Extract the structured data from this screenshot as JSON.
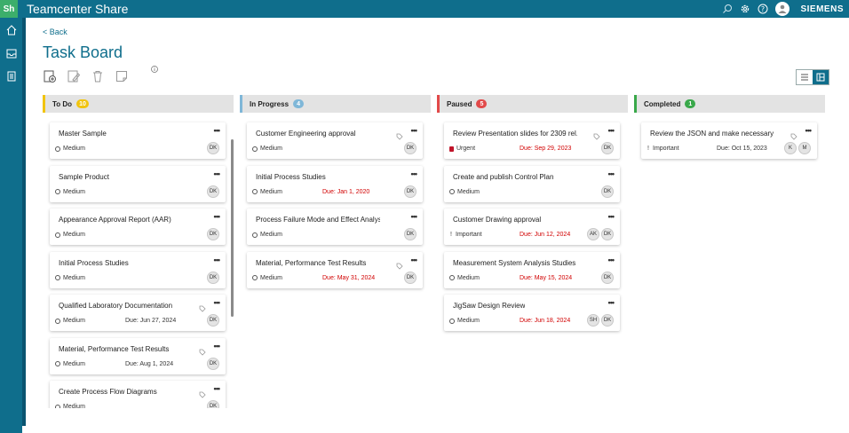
{
  "app": {
    "logo": "Sh",
    "title": "Teamcenter Share",
    "brand": "SIEMENS"
  },
  "topbar_icons": [
    "search-icon",
    "gear-icon",
    "help-icon",
    "user-avatar-icon"
  ],
  "rail_icons": [
    "home-icon",
    "inbox-icon",
    "tasks-icon"
  ],
  "nav": {
    "back": "< Back"
  },
  "page": {
    "title": "Task Board"
  },
  "toolbar_icons": [
    "add-task-icon",
    "edit-icon",
    "delete-icon",
    "note-icon"
  ],
  "colors": {
    "primary": "#0f6e8c",
    "todo": "#f1c40f",
    "inprogress": "#7fb7d8",
    "paused": "#e24a4a",
    "completed": "#39a84a",
    "overdue": "#d10000"
  },
  "columns": [
    {
      "name": "To Do",
      "count": "10",
      "cards": [
        {
          "title": "Master Sample",
          "priority": "Medium",
          "due": "",
          "overdue": false,
          "tag": false,
          "assignees": [
            "DK"
          ]
        },
        {
          "title": "Sample Product",
          "priority": "Medium",
          "due": "",
          "overdue": false,
          "tag": false,
          "assignees": [
            "DK"
          ]
        },
        {
          "title": "Appearance Approval Report (AAR)",
          "priority": "Medium",
          "due": "",
          "overdue": false,
          "tag": false,
          "assignees": [
            "DK"
          ]
        },
        {
          "title": "Initial Process Studies",
          "priority": "Medium",
          "due": "",
          "overdue": false,
          "tag": false,
          "assignees": [
            "DK"
          ]
        },
        {
          "title": "Qualified Laboratory Documentation",
          "priority": "Medium",
          "due": "Due: Jun 27, 2024",
          "overdue": false,
          "tag": true,
          "assignees": [
            "DK"
          ]
        },
        {
          "title": "Material, Performance Test Results",
          "priority": "Medium",
          "due": "Due: Aug 1, 2024",
          "overdue": false,
          "tag": true,
          "assignees": [
            "DK"
          ]
        },
        {
          "title": "Create Process Flow Diagrams",
          "priority": "Medium",
          "due": "",
          "overdue": false,
          "tag": true,
          "assignees": [
            "DK"
          ]
        }
      ]
    },
    {
      "name": "In Progress",
      "count": "4",
      "cards": [
        {
          "title": "Customer Engineering approval",
          "priority": "Medium",
          "due": "",
          "overdue": false,
          "tag": true,
          "assignees": [
            "DK"
          ]
        },
        {
          "title": "Initial Process Studies",
          "priority": "Medium",
          "due": "Due: Jan 1, 2020",
          "overdue": true,
          "tag": false,
          "assignees": [
            "DK"
          ]
        },
        {
          "title": "Process Failure Mode and Effect Analysi...",
          "priority": "Medium",
          "due": "",
          "overdue": false,
          "tag": false,
          "assignees": [
            "DK"
          ]
        },
        {
          "title": "Material, Performance Test Results",
          "priority": "Medium",
          "due": "Due: May 31, 2024",
          "overdue": true,
          "tag": true,
          "assignees": [
            "DK"
          ]
        }
      ]
    },
    {
      "name": "Paused",
      "count": "5",
      "cards": [
        {
          "title": "Review Presentation slides for 2309 rel...",
          "priority": "Urgent",
          "due": "Due: Sep 29, 2023",
          "overdue": true,
          "tag": true,
          "assignees": [
            "DK"
          ]
        },
        {
          "title": "Create and publish Control Plan",
          "priority": "Medium",
          "due": "",
          "overdue": false,
          "tag": false,
          "assignees": [
            "DK"
          ]
        },
        {
          "title": "Customer Drawing approval",
          "priority": "Important",
          "due": "Due: Jun 12, 2024",
          "overdue": true,
          "tag": false,
          "assignees": [
            "AK",
            "DK"
          ]
        },
        {
          "title": "Measurement System Analysis Studies",
          "priority": "Medium",
          "due": "Due: May 15, 2024",
          "overdue": true,
          "tag": false,
          "assignees": [
            "DK"
          ]
        },
        {
          "title": "JigSaw Design Review",
          "priority": "Medium",
          "due": "Due: Jun 18, 2024",
          "overdue": true,
          "tag": false,
          "assignees": [
            "SH",
            "DK"
          ]
        }
      ]
    },
    {
      "name": "Completed",
      "count": "1",
      "cards": [
        {
          "title": "Review the JSON and make necessary c...",
          "priority": "Important",
          "due": "Due: Oct 15, 2023",
          "overdue": false,
          "tag": true,
          "assignees": [
            "K",
            "M"
          ]
        }
      ]
    }
  ]
}
